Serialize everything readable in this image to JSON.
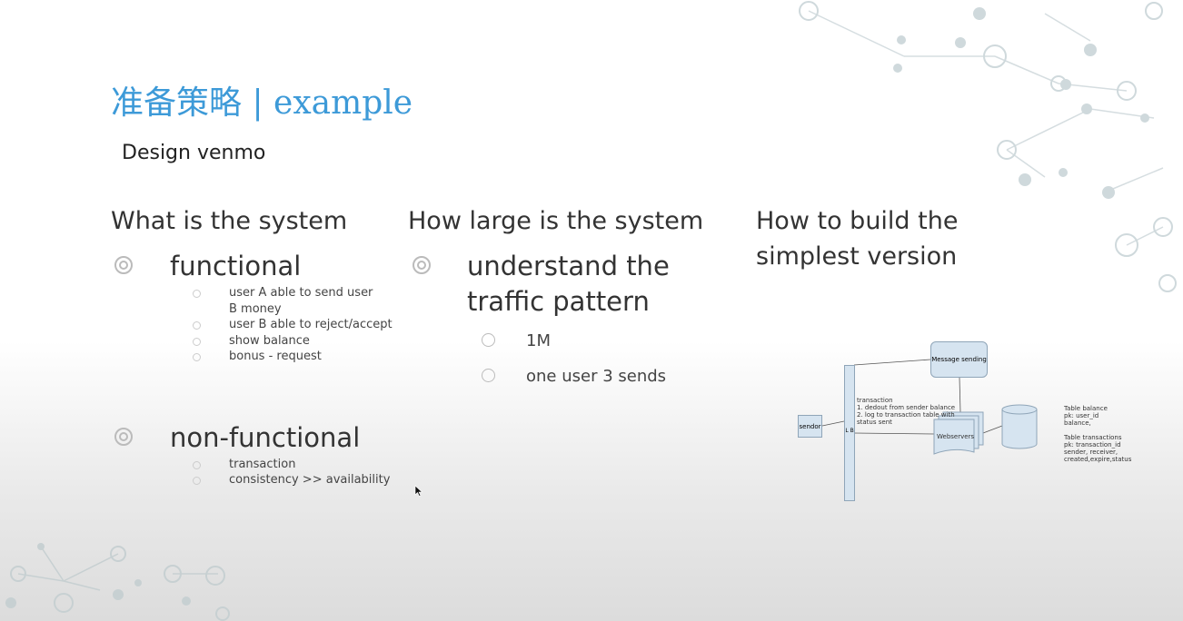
{
  "slide": {
    "title": "准备策略 | example",
    "subtitle": "Design venmo"
  },
  "columns": [
    {
      "heading": "What is the system",
      "items": [
        {
          "label": "functional",
          "subitems": [
            "user A able to send user B money",
            "user B able to reject/accept",
            "show balance",
            "bonus - request"
          ]
        },
        {
          "label": "non-functional",
          "subitems": [
            "transaction",
            "consistency >> availability"
          ]
        }
      ]
    },
    {
      "heading": "How large is the system",
      "items": [
        {
          "label": "understand the traffic pattern",
          "subitems": [
            "1M",
            "one user 3 sends"
          ]
        }
      ]
    },
    {
      "heading": "How to build the simplest version"
    }
  ],
  "diagram": {
    "sender": "sendor",
    "lb": "L B",
    "message": "Message sending",
    "webservers": "Webservers",
    "transaction_note": [
      "transaction",
      "1. dedout from sender balance",
      "2. log to transaction table with",
      "status sent"
    ],
    "tables": [
      "Table balance",
      "pk: user_id",
      "balance,",
      "",
      "Table transactions",
      "pk: transaction_id",
      "sender, receiver,",
      "created,expire,status"
    ]
  },
  "colors": {
    "title": "#3d9ad8",
    "box": "#d6e4f0"
  }
}
